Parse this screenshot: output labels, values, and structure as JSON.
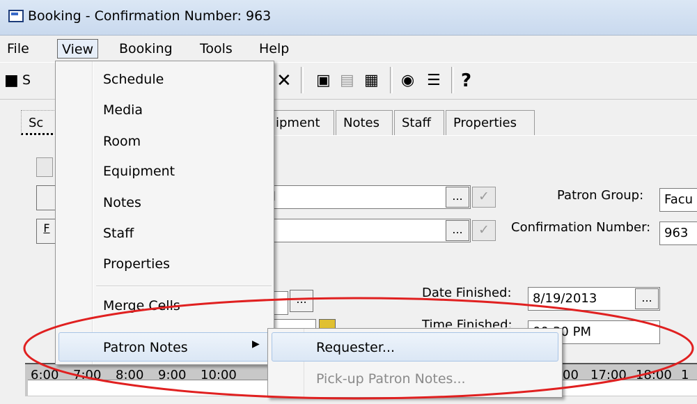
{
  "window": {
    "title": "Booking - Confirmation Number: 963"
  },
  "menubar": {
    "file": "File",
    "view": "View",
    "booking": "Booking",
    "tools": "Tools",
    "help": "Help"
  },
  "toolbar": {
    "save_label_partial": "S"
  },
  "tabs": {
    "first_partial": "Sc",
    "equipment_partial": "ipment",
    "notes": "Notes",
    "staff": "Staff",
    "properties": "Properties"
  },
  "form": {
    "patron_group_label": "Patron Group:",
    "patron_group_value": "Facu",
    "confirmation_label": "Confirmation Number:",
    "confirmation_value": "963",
    "date_finished_label": "Date Finished:",
    "date_finished_value": "8/19/2013",
    "time_finished_label": "Time Finished:",
    "time_finished_value": "00:30 PM",
    "field1_partial": "l",
    "ellipsis": "...",
    "left_btn_partial": "F"
  },
  "view_menu": {
    "items": [
      "Schedule",
      "Media",
      "Room",
      "Equipment",
      "Notes",
      "Staff",
      "Properties"
    ],
    "merge_cells": "Merge Cells",
    "patron_notes": "Patron Notes"
  },
  "patron_notes_submenu": {
    "requester": "Requester...",
    "pickup": "Pick-up Patron Notes..."
  },
  "timeline": {
    "ticks": [
      "6:00",
      "7:00",
      "8:00",
      "9:00",
      "10:00",
      "00",
      "17:00",
      "18:00",
      "1"
    ]
  },
  "colors": {
    "highlight_border": "#a8c4e6",
    "annotation": "#e02020",
    "disabled_text": "#8a8a8a"
  }
}
